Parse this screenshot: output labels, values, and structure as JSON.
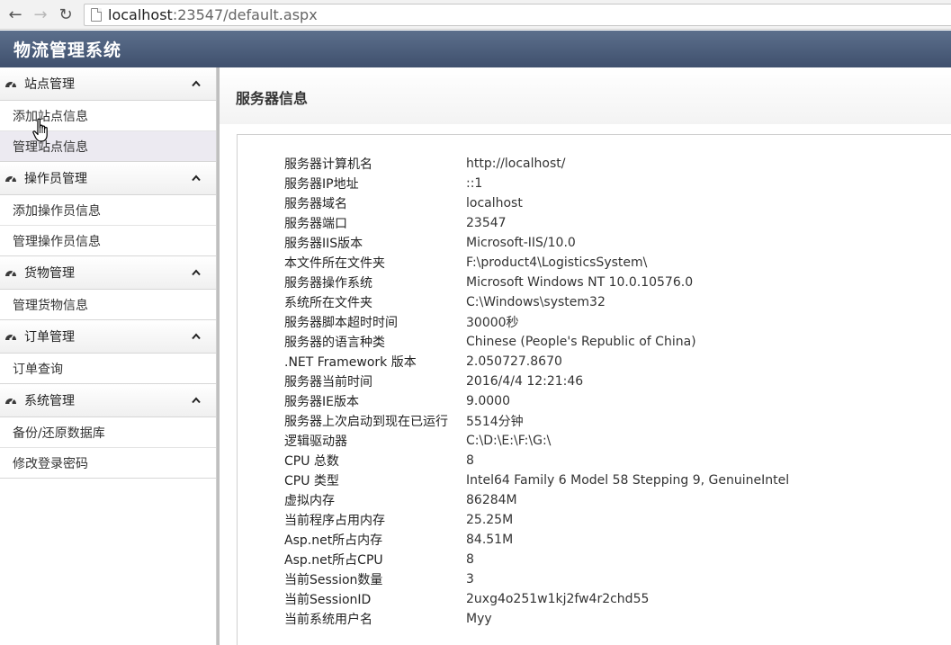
{
  "browser": {
    "back_glyph": "←",
    "forward_glyph": "→",
    "reload_glyph": "↻",
    "url_host": "localhost",
    "url_rest": ":23547/default.aspx"
  },
  "app": {
    "title": "物流管理系统"
  },
  "sidebar": {
    "groups": [
      {
        "label": "站点管理",
        "items": [
          "添加站点信息",
          "管理站点信息"
        ]
      },
      {
        "label": "操作员管理",
        "items": [
          "添加操作员信息",
          "管理操作员信息"
        ]
      },
      {
        "label": "货物管理",
        "items": [
          "管理货物信息"
        ]
      },
      {
        "label": "订单管理",
        "items": [
          "订单查询"
        ]
      },
      {
        "label": "系统管理",
        "items": [
          "备份/还原数据库",
          "修改登录密码"
        ]
      }
    ]
  },
  "main": {
    "title": "服务器信息",
    "rows": [
      {
        "key": "服务器计算机名",
        "value": "http://localhost/"
      },
      {
        "key": "服务器IP地址",
        "value": "::1"
      },
      {
        "key": "服务器域名",
        "value": "localhost"
      },
      {
        "key": "服务器端口",
        "value": "23547"
      },
      {
        "key": "服务器IIS版本",
        "value": "Microsoft-IIS/10.0"
      },
      {
        "key": "本文件所在文件夹",
        "value": "F:\\product4\\LogisticsSystem\\"
      },
      {
        "key": "服务器操作系统",
        "value": "Microsoft Windows NT 10.0.10576.0"
      },
      {
        "key": "系统所在文件夹",
        "value": "C:\\Windows\\system32"
      },
      {
        "key": "服务器脚本超时时间",
        "value": "30000秒"
      },
      {
        "key": "服务器的语言种类",
        "value": "Chinese (People's Republic of China)"
      },
      {
        "key": ".NET Framework 版本",
        "value": "2.050727.8670"
      },
      {
        "key": "服务器当前时间",
        "value": "2016/4/4 12:21:46"
      },
      {
        "key": "服务器IE版本",
        "value": "9.0000"
      },
      {
        "key": "服务器上次启动到现在已运行",
        "value": "5514分钟"
      },
      {
        "key": "逻辑驱动器",
        "value": "C:\\D:\\E:\\F:\\G:\\"
      },
      {
        "key": "CPU 总数",
        "value": "8"
      },
      {
        "key": "CPU 类型",
        "value": "Intel64 Family 6 Model 58 Stepping 9, GenuineIntel"
      },
      {
        "key": "虚拟内存",
        "value": "86284M"
      },
      {
        "key": "当前程序占用内存",
        "value": "25.25M"
      },
      {
        "key": "Asp.net所占内存",
        "value": "84.51M"
      },
      {
        "key": "Asp.net所占CPU",
        "value": "8"
      },
      {
        "key": "当前Session数量",
        "value": "3"
      },
      {
        "key": "当前SessionID",
        "value": "2uxg4o251w1kj2fw4r2chd55"
      },
      {
        "key": "当前系统用户名",
        "value": "Myy"
      }
    ]
  }
}
